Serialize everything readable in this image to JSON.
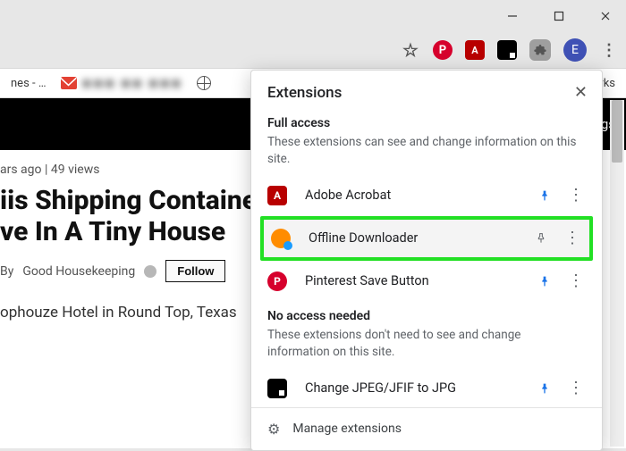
{
  "window": {
    "minimize": "minimize",
    "maximize": "maximize",
    "close": "close"
  },
  "toolbar": {
    "star": "☆",
    "avatar_letter": "E",
    "kebab": "⋮"
  },
  "bookmarks": {
    "item1_suffix": "nes - …",
    "blurred": "◼◼◼  ◼◼  ◼◼◼",
    "other": "bookmarks"
  },
  "page": {
    "blackbar_right": "gs",
    "meta": "ars ago  |  49 views",
    "headline_line1": "iis Shipping Container H",
    "headline_line2": "ve In A Tiny House",
    "by_label": "By",
    "author": "Good Housekeeping",
    "follow": "Follow",
    "subhead": "ophouze Hotel in Round Top, Texas"
  },
  "popup": {
    "title": "Extensions",
    "section_full_title": "Full access",
    "section_full_desc": "These extensions can see and change information on this site.",
    "extensions_full": [
      {
        "name": "Adobe Acrobat",
        "pinned": true
      },
      {
        "name": "Offline Downloader",
        "pinned": false,
        "highlight": true
      },
      {
        "name": "Pinterest Save Button",
        "pinned": true
      }
    ],
    "section_none_title": "No access needed",
    "section_none_desc": "These extensions don't need to see and change information on this site.",
    "extensions_none": [
      {
        "name": "Change JPEG/JFIF to JPG",
        "pinned": true
      }
    ],
    "manage": "Manage extensions"
  }
}
